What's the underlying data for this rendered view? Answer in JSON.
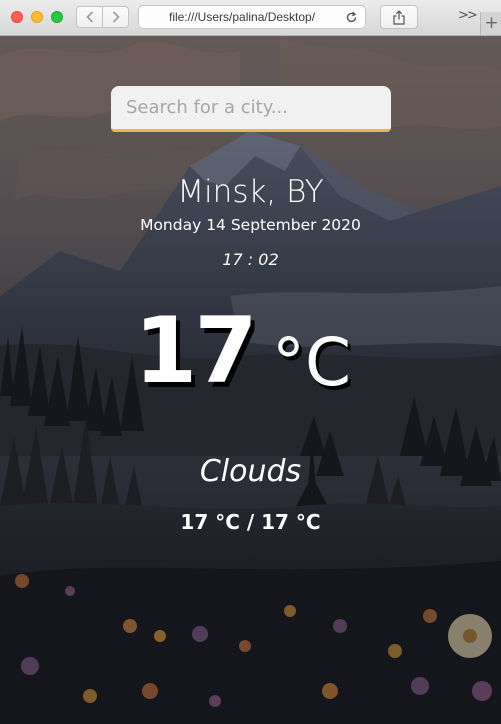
{
  "browser": {
    "url": "file:///Users/palina/Desktop/",
    "back_icon": "chevron-left-icon",
    "forward_icon": "chevron-right-icon",
    "reload_icon": "reload-icon",
    "share_icon": "share-icon",
    "more_label": ">>",
    "new_tab_label": "+"
  },
  "search": {
    "placeholder": "Search for a city...",
    "value": "",
    "underline_color": "#e8b84b"
  },
  "weather": {
    "city": "Minsk, BY",
    "date": "Monday 14 September 2020",
    "time": "17 : 02",
    "temperature": "17",
    "unit": "°C",
    "description": "Clouds",
    "range": "17 °C / 17 °C"
  }
}
